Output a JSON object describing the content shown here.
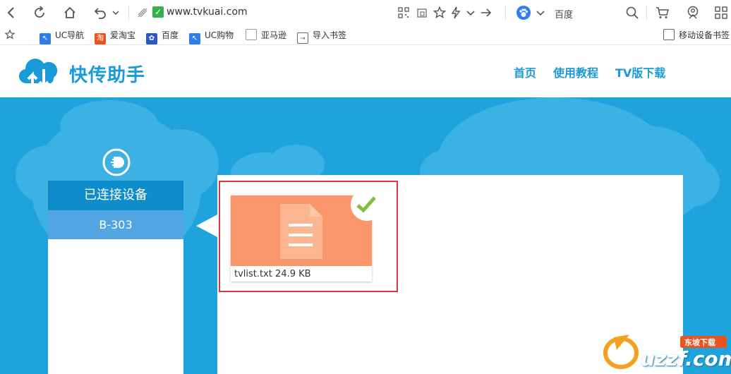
{
  "browser": {
    "url": "www.tvkuai.com",
    "search_engine": "百度"
  },
  "bookmarks": [
    {
      "label": "UC导航",
      "color": "#2d7ee6"
    },
    {
      "label": "爱淘宝",
      "color": "#e8541e"
    },
    {
      "label": "百度",
      "color": "#2d56c9"
    },
    {
      "label": "UC购物",
      "color": "#2d7ee6"
    },
    {
      "label": "亚马逊",
      "color": "#999999"
    },
    {
      "label": "导入书签",
      "color": "#666666"
    }
  ],
  "bookmarks_right": "移动设备书签",
  "site": {
    "title": "快传助手",
    "nav": [
      "首页",
      "使用教程",
      "TV版下载"
    ]
  },
  "sidebar": {
    "heading": "已连接设备",
    "devices": [
      "B-303"
    ]
  },
  "files": [
    {
      "name": "tvlist.txt",
      "size": "24.9 KB",
      "selected": true
    }
  ],
  "colors": {
    "brand": "#1a9ad6",
    "hero_bg": "#1fa3dc",
    "device_active": "#52a5e1",
    "thumb": "#f9976a",
    "selection": "#d9373f",
    "check": "#7cc243"
  },
  "watermark": {
    "brand": "uzzf.com",
    "tag": "东坡下载"
  }
}
